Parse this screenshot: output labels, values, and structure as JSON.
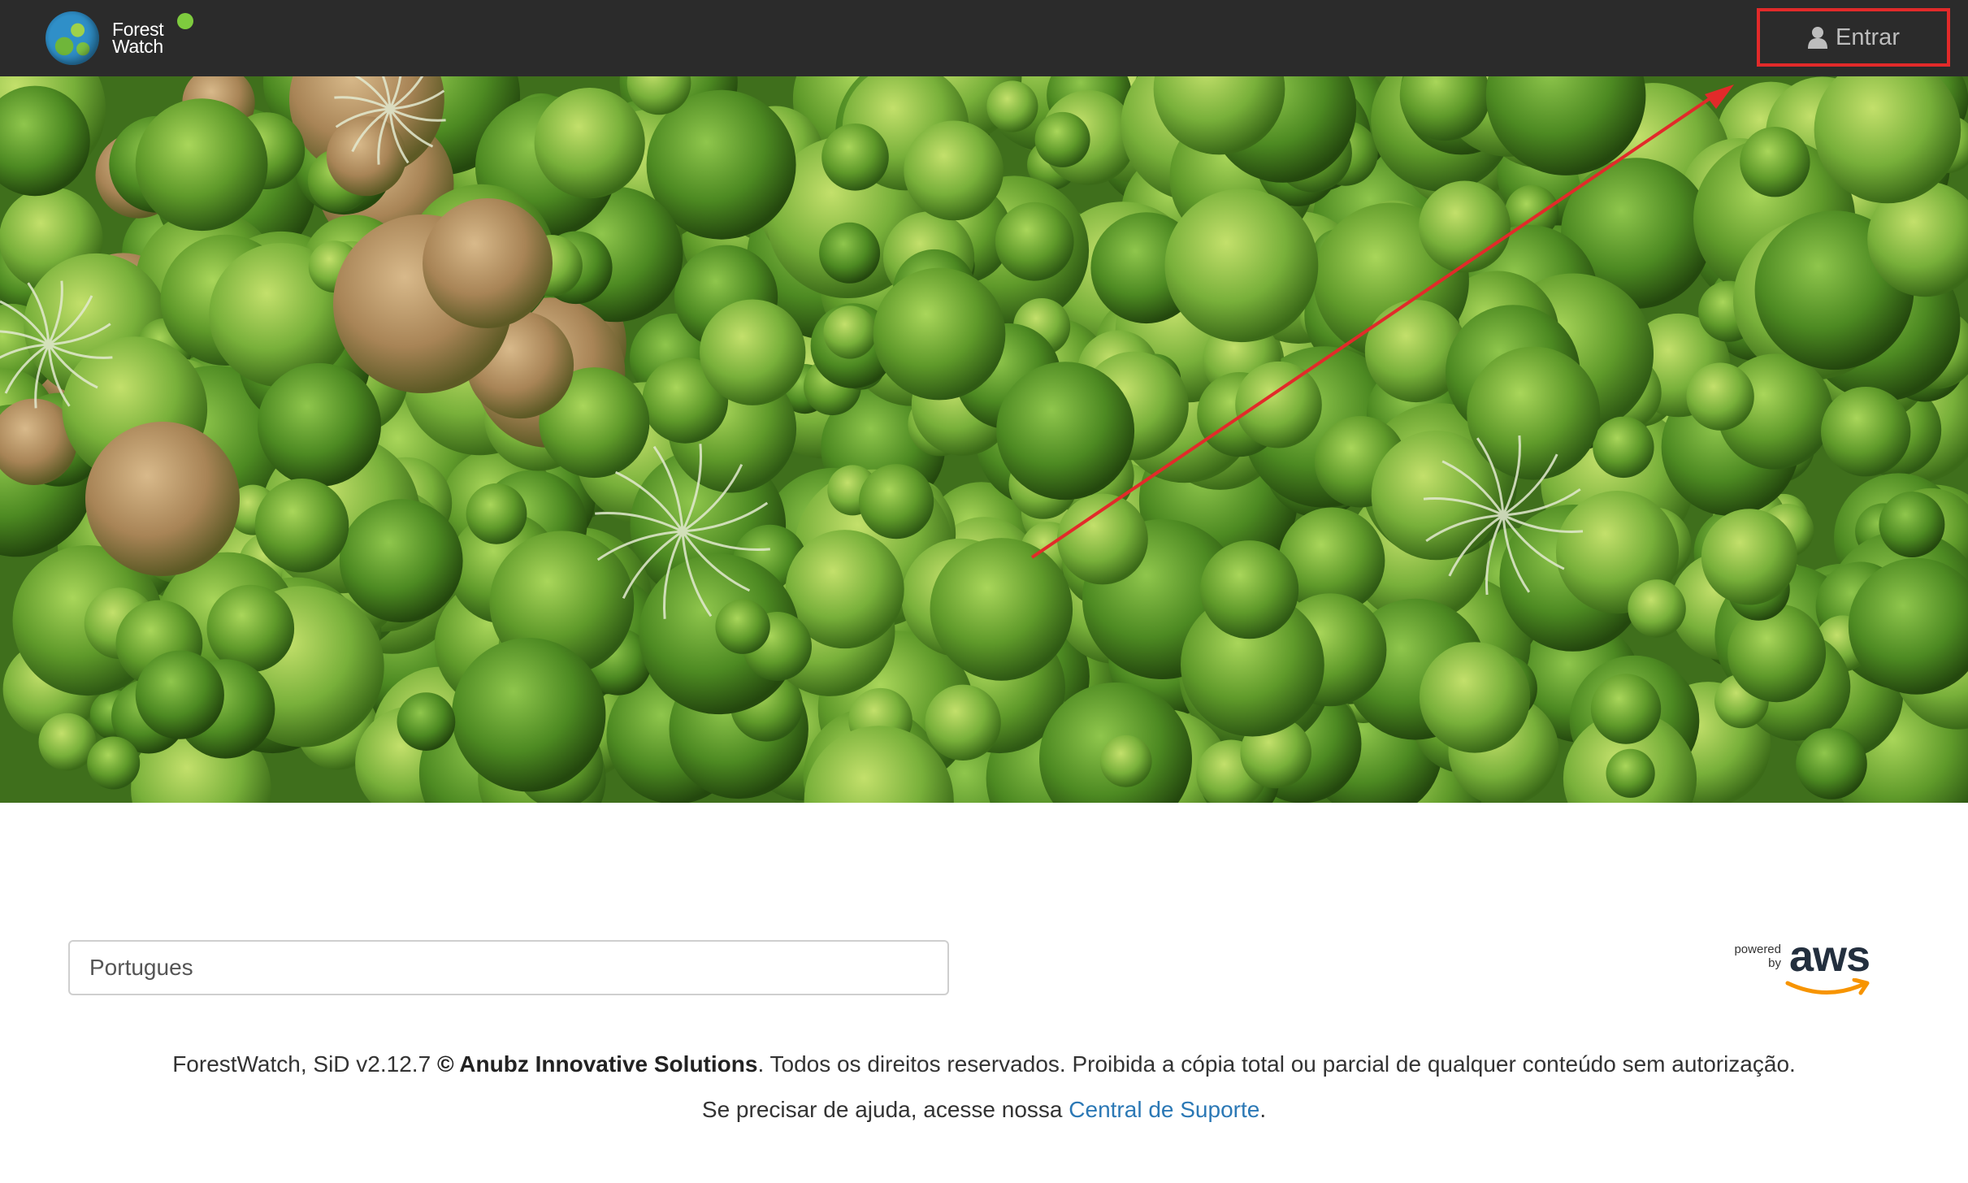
{
  "navbar": {
    "brand_line1": "Forest",
    "brand_line2": "Watch",
    "status_color": "#7ecb3e",
    "login_label": "Entrar",
    "login_icon": "user-icon",
    "highlight_color": "#e22a2a"
  },
  "language": {
    "selected": "Portugues"
  },
  "aws": {
    "powered_line1": "powered",
    "powered_line2": "by",
    "logo_text": "aws"
  },
  "footer": {
    "version_text": "ForestWatch, SiD v2.12.7 ",
    "company": "© Anubz Innovative Solutions",
    "rights_text": ". Todos os direitos reservados. Proibida a cópia total ou parcial de qualquer conteúdo sem autorização.",
    "help_prefix": "Se precisar de ajuda, acesse nossa ",
    "help_link": "Central de Suporte",
    "help_suffix": "."
  }
}
